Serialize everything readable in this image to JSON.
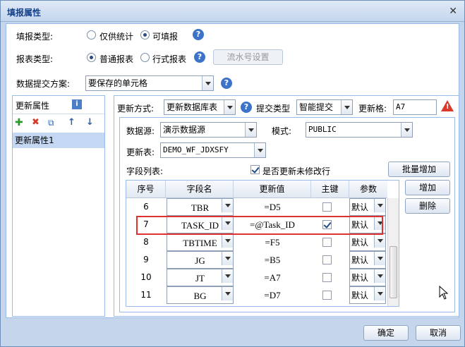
{
  "dialog": {
    "title": "填报属性"
  },
  "fill_type": {
    "label": "填报类型:",
    "options": [
      "仅供统计",
      "可填报"
    ],
    "selected": 1
  },
  "report_type": {
    "label": "报表类型:",
    "options": [
      "普通报表",
      "行式报表"
    ],
    "selected": 0,
    "serial_button": "流水号设置"
  },
  "submit_scheme": {
    "label": "数据提交方案:",
    "value": "要保存的单元格"
  },
  "left_panel": {
    "title": "更新属性",
    "items": [
      "更新属性1"
    ]
  },
  "right_panel": {
    "update_mode_label": "更新方式:",
    "update_mode_value": "更新数据库表",
    "submit_type_label": "提交类型",
    "submit_type_value": "智能提交",
    "update_cell_label": "更新格:",
    "update_cell_value": "A7",
    "datasource_label": "数据源:",
    "datasource_value": "演示数据源",
    "schema_label": "模式:",
    "schema_value": "PUBLIC",
    "table_label": "更新表:",
    "table_value": "DEMO_WF_JDXSFY",
    "field_list_label": "字段列表:",
    "update_unmodified_label": "是否更新未修改行",
    "update_unmodified_checked": true,
    "batch_add_button": "批量增加",
    "add_button": "增加",
    "delete_button": "删除"
  },
  "grid": {
    "columns": [
      "序号",
      "字段名",
      "更新值",
      "主键",
      "参数"
    ],
    "rows": [
      {
        "seq": "6",
        "field": "TBR",
        "value": "=D5",
        "pk": false,
        "param": "默认"
      },
      {
        "seq": "7",
        "field": "TASK_ID",
        "value": "=@Task_ID",
        "pk": true,
        "param": "默认"
      },
      {
        "seq": "8",
        "field": "TBTIME",
        "value": "=F5",
        "pk": false,
        "param": "默认"
      },
      {
        "seq": "9",
        "field": "JG",
        "value": "=B5",
        "pk": false,
        "param": "默认"
      },
      {
        "seq": "10",
        "field": "JT",
        "value": "=A7",
        "pk": false,
        "param": "默认"
      },
      {
        "seq": "11",
        "field": "BG",
        "value": "=D7",
        "pk": false,
        "param": "默认"
      }
    ],
    "highlight_color": "#e03131"
  },
  "footer": {
    "ok": "确定",
    "cancel": "取消"
  }
}
